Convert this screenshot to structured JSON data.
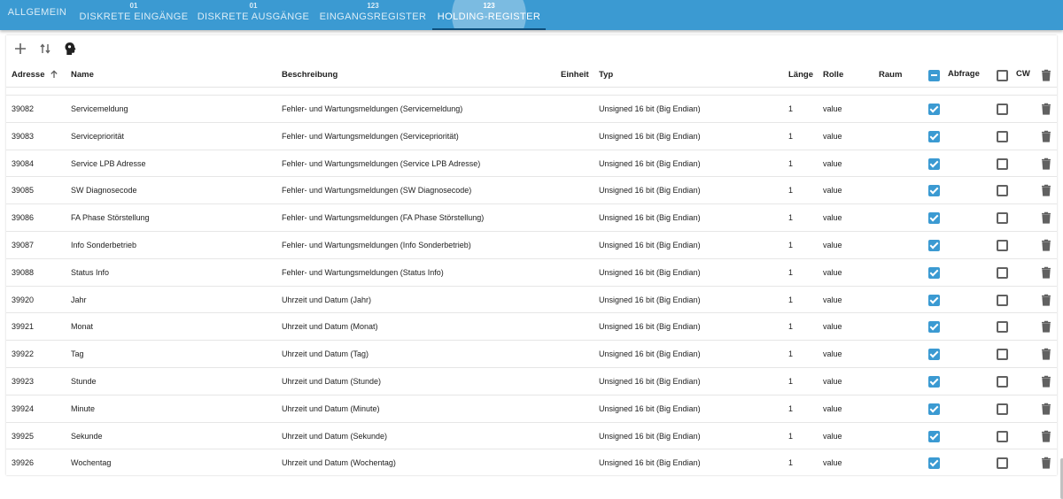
{
  "tabs": [
    {
      "label": "ALLGEMEIN",
      "icon": ""
    },
    {
      "label": "DISKRETE EINGÄNGE",
      "icon": "01"
    },
    {
      "label": "DISKRETE AUSGÄNGE",
      "icon": "01"
    },
    {
      "label": "EINGANGSREGISTER",
      "icon": "123"
    },
    {
      "label": "HOLDING-REGISTER",
      "icon": "123"
    }
  ],
  "active_tab": "HOLDING-REGISTER",
  "toolbar": {
    "icons": [
      "plus-icon",
      "import-export-icon",
      "brain-head-icon"
    ]
  },
  "table": {
    "headers": {
      "address": "Adresse",
      "name": "Name",
      "description": "Beschreibung",
      "unit": "Einheit",
      "type": "Typ",
      "length": "Länge",
      "role": "Rolle",
      "room": "Raum",
      "poll": "Abfrage",
      "cw": "CW"
    },
    "sort": {
      "column": "Adresse",
      "direction": "ascending"
    },
    "poll_header_state": "indeterminate",
    "cw_header_state": "unchecked",
    "rows": [
      {
        "address": "39082",
        "name": "Servicemeldung",
        "description": "Fehler- und Wartungsmeldungen (Servicemeldung)",
        "unit": "",
        "type": "Unsigned 16 bit (Big Endian)",
        "length": "1",
        "role": "value",
        "room": "",
        "poll": true,
        "cw": false
      },
      {
        "address": "39083",
        "name": "Servicepriorität",
        "description": "Fehler- und Wartungsmeldungen (Servicepriorität)",
        "unit": "",
        "type": "Unsigned 16 bit (Big Endian)",
        "length": "1",
        "role": "value",
        "room": "",
        "poll": true,
        "cw": false
      },
      {
        "address": "39084",
        "name": "Service LPB Adresse",
        "description": "Fehler- und Wartungsmeldungen (Service LPB Adresse)",
        "unit": "",
        "type": "Unsigned 16 bit (Big Endian)",
        "length": "1",
        "role": "value",
        "room": "",
        "poll": true,
        "cw": false
      },
      {
        "address": "39085",
        "name": "SW Diagnosecode",
        "description": "Fehler- und Wartungsmeldungen (SW Diagnosecode)",
        "unit": "",
        "type": "Unsigned 16 bit (Big Endian)",
        "length": "1",
        "role": "value",
        "room": "",
        "poll": true,
        "cw": false
      },
      {
        "address": "39086",
        "name": "FA Phase Störstellung",
        "description": "Fehler- und Wartungsmeldungen (FA Phase Störstellung)",
        "unit": "",
        "type": "Unsigned 16 bit (Big Endian)",
        "length": "1",
        "role": "value",
        "room": "",
        "poll": true,
        "cw": false
      },
      {
        "address": "39087",
        "name": "Info Sonderbetrieb",
        "description": "Fehler- und Wartungsmeldungen (Info Sonderbetrieb)",
        "unit": "",
        "type": "Unsigned 16 bit (Big Endian)",
        "length": "1",
        "role": "value",
        "room": "",
        "poll": true,
        "cw": false
      },
      {
        "address": "39088",
        "name": "Status Info",
        "description": "Fehler- und Wartungsmeldungen (Status Info)",
        "unit": "",
        "type": "Unsigned 16 bit (Big Endian)",
        "length": "1",
        "role": "value",
        "room": "",
        "poll": true,
        "cw": false
      },
      {
        "address": "39920",
        "name": "Jahr",
        "description": "Uhrzeit und Datum (Jahr)",
        "unit": "",
        "type": "Unsigned 16 bit (Big Endian)",
        "length": "1",
        "role": "value",
        "room": "",
        "poll": true,
        "cw": false
      },
      {
        "address": "39921",
        "name": "Monat",
        "description": "Uhrzeit und Datum (Monat)",
        "unit": "",
        "type": "Unsigned 16 bit (Big Endian)",
        "length": "1",
        "role": "value",
        "room": "",
        "poll": true,
        "cw": false
      },
      {
        "address": "39922",
        "name": "Tag",
        "description": "Uhrzeit und Datum (Tag)",
        "unit": "",
        "type": "Unsigned 16 bit (Big Endian)",
        "length": "1",
        "role": "value",
        "room": "",
        "poll": true,
        "cw": false
      },
      {
        "address": "39923",
        "name": "Stunde",
        "description": "Uhrzeit und Datum (Stunde)",
        "unit": "",
        "type": "Unsigned 16 bit (Big Endian)",
        "length": "1",
        "role": "value",
        "room": "",
        "poll": true,
        "cw": false
      },
      {
        "address": "39924",
        "name": "Minute",
        "description": "Uhrzeit und Datum (Minute)",
        "unit": "",
        "type": "Unsigned 16 bit (Big Endian)",
        "length": "1",
        "role": "value",
        "room": "",
        "poll": true,
        "cw": false
      },
      {
        "address": "39925",
        "name": "Sekunde",
        "description": "Uhrzeit und Datum (Sekunde)",
        "unit": "",
        "type": "Unsigned 16 bit (Big Endian)",
        "length": "1",
        "role": "value",
        "room": "",
        "poll": true,
        "cw": false
      },
      {
        "address": "39926",
        "name": "Wochentag",
        "description": "Uhrzeit und Datum (Wochentag)",
        "unit": "",
        "type": "Unsigned 16 bit (Big Endian)",
        "length": "1",
        "role": "value",
        "room": "",
        "poll": true,
        "cw": false
      }
    ]
  },
  "colors": {
    "accent": "#3b9ad2",
    "active_indicator": "#0d4f7c",
    "icon": "#616161"
  }
}
